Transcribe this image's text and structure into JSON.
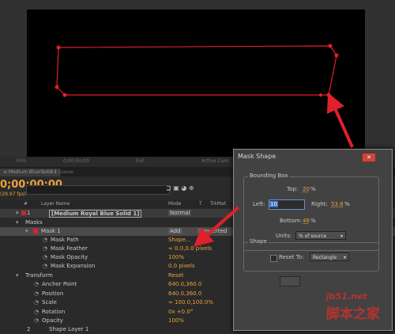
{
  "viewer": {
    "zoom": "50%",
    "timecode_small": "0;00;00;00",
    "resolution": "Full",
    "camera": "Active Cam"
  },
  "tabs": {
    "comp": "≡ Medium Blue Solid 1",
    "other": "Render Queue"
  },
  "timeline": {
    "timecode": "0;00;00;00",
    "fps": "(29.97 fps)",
    "columns": {
      "num": "#",
      "layer_name": "Layer Name",
      "mode": "Mode",
      "t": "T",
      "trkmat": "TrkMat"
    },
    "layer": {
      "num": "1",
      "name": "[Medium Royal Blue Solid 1]",
      "mode": "Normal"
    },
    "masks_label": "Masks",
    "mask1": {
      "name": "Mask 1",
      "mode": "Add",
      "inverted": "Inverted"
    },
    "props": [
      {
        "name": "Mask Path",
        "value": "Shape..."
      },
      {
        "name": "Mask Feather",
        "value": "∞ 0.0,0.0 pixels"
      },
      {
        "name": "Mask Opacity",
        "value": "100%"
      },
      {
        "name": "Mask Expansion",
        "value": "0.0 pixels"
      }
    ],
    "transform": {
      "label": "Transform",
      "reset": "Reset"
    },
    "transform_props": [
      {
        "name": "Anchor Point",
        "value": "640.0,360.0"
      },
      {
        "name": "Position",
        "value": "640.0,360.0"
      },
      {
        "name": "Scale",
        "value": "∞ 100.0,100.0%"
      },
      {
        "name": "Rotation",
        "value": "0x +0.0°"
      },
      {
        "name": "Opacity",
        "value": "100%"
      }
    ],
    "layer2": {
      "num": "2",
      "name": "Shape Layer 1"
    }
  },
  "dialog": {
    "title": "Mask Shape",
    "close": "✕",
    "bounding_box": {
      "label": "Bounding Box",
      "top_label": "Top:",
      "top_value": "20",
      "top_unit": "%",
      "left_label": "Left:",
      "left_value": "10",
      "right_label": "Right:",
      "right_value": "53.8",
      "right_unit": "%",
      "bottom_label": "Bottom:",
      "bottom_value": "46",
      "bottom_unit": "%",
      "units_label": "Units:",
      "units_value": "% of source"
    },
    "shape": {
      "label": "Shape",
      "reset_to": "Reset To:",
      "reset_value": "Rectangle"
    }
  },
  "watermark": {
    "logo": "jb51.net",
    "text": "脚本之家"
  },
  "colors": {
    "accent": "#e9a23b",
    "mask": "#e0202a",
    "dialog_bg": "#424242"
  }
}
